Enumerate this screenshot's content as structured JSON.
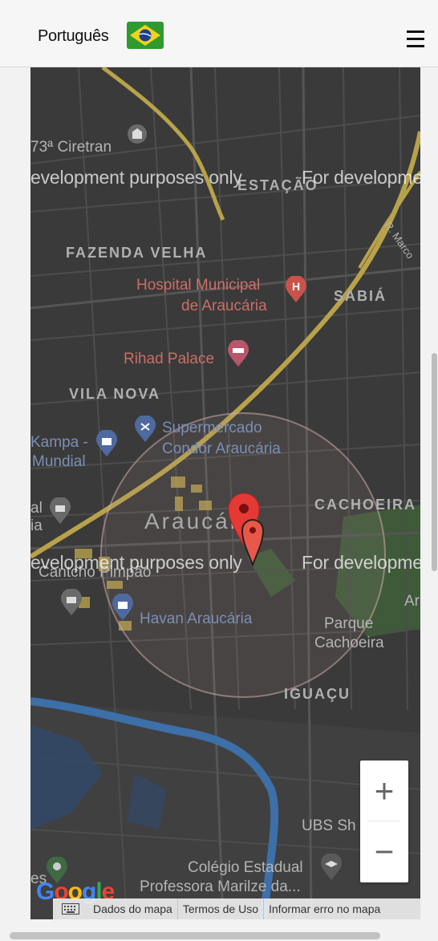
{
  "header": {
    "language_label": "Português",
    "flag_icon": "brazil-flag-icon",
    "menu_icon": "hamburger-menu-icon"
  },
  "map": {
    "labels": {
      "ciretran": "73ª Ciretran",
      "estacao": "ESTAÇÃO",
      "marco": "R. Marco",
      "fazenda": "FAZENDA VELHA",
      "hospital_1": "Hospital Municipal",
      "hospital_2": "de Araucária",
      "sabia": "SABIÁ",
      "rihad": "Rihad Palace",
      "vila_nova": "VILA NOVA",
      "super_1": "Supermercado",
      "super_2": "Condor Araucária",
      "kampa_1": "Kampa -",
      "kampa_2": "Mundial",
      "al": "al",
      "ia": "ia",
      "cachoeira": "CACHOEIRA",
      "city": "Araucária",
      "cantcho": "Cantcho Pimpão",
      "havan": "Havan Araucária",
      "ar": "Ar",
      "parque_1": "Parque",
      "parque_2": "Cachoeira",
      "iguacu": "IGUAÇU",
      "ubs": "UBS Sh",
      "colegio_1": "Colégio Estadual",
      "colegio_2": "Professora Marilze da...",
      "es": "es"
    },
    "watermark": "For development purposes only",
    "watermark_top_left": "evelopment purposes only",
    "watermark_top_right": "For developme",
    "watermark_mid_left": "evelopment purposes only",
    "watermark_mid_right": "For developme",
    "zoom_in": "+",
    "zoom_out": "−",
    "google_logo": "Google",
    "footer": {
      "keyboard_icon": "keyboard-icon",
      "map_data": "Dados do mapa",
      "terms": "Termos de Uso",
      "report": "Informar erro no mapa"
    }
  },
  "colors": {
    "marker_red": "#e53935",
    "road_yellow": "#b8a24a",
    "water_blue": "#3d6fa8",
    "park_green": "#3f5e3a"
  }
}
